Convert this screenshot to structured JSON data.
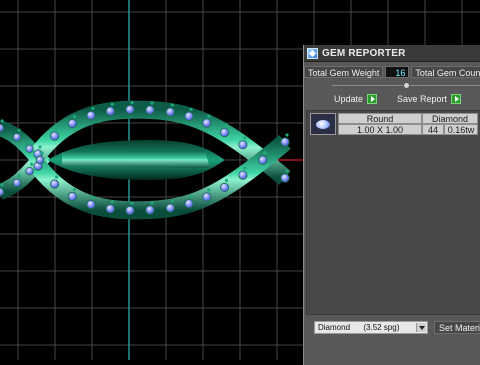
{
  "panel": {
    "title": "GEM REPORTER",
    "total_weight_label": "Total Gem Weight",
    "total_weight_value": "16",
    "total_count_label": "Total Gem Coun",
    "update_label": "Update",
    "save_report_label": "Save Report",
    "columns": {
      "shape": "Round",
      "material": "Diamond"
    },
    "gems": [
      {
        "size": "1.00 X 1.00",
        "count": "44",
        "weight": "0.16tw"
      }
    ],
    "material_select": "Diamond      (3.52 spg)",
    "set_material_label": "Set Materia"
  },
  "viewport": {
    "background": "#000000",
    "grid_color": "#6a6a6a",
    "axis_color": "#2ab6b6",
    "axis_red": "#d11b1b",
    "metal_color": "#0a7a5f",
    "gem_color": "#7d8cff"
  },
  "icons": {
    "app": "gem-reporter-icon",
    "update": "play-icon",
    "save": "play-icon",
    "dropdown": "chevron-down-icon"
  }
}
